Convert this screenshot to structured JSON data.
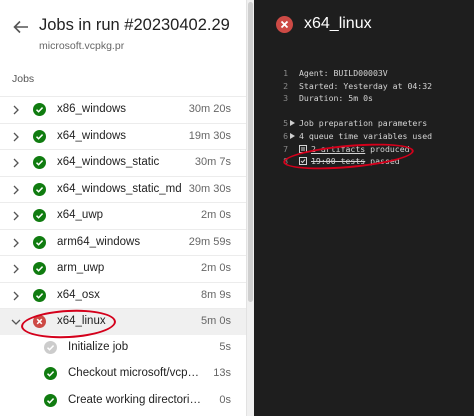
{
  "header": {
    "title": "Jobs in run #20230402.29",
    "subtitle": "microsoft.vcpkg.pr"
  },
  "jobs_heading": "Jobs",
  "jobs": [
    {
      "name": "x86_windows",
      "duration": "30m 20s",
      "status": "success"
    },
    {
      "name": "x64_windows",
      "duration": "19m 30s",
      "status": "success"
    },
    {
      "name": "x64_windows_static",
      "duration": "30m 7s",
      "status": "success"
    },
    {
      "name": "x64_windows_static_md",
      "duration": "30m 30s",
      "status": "success"
    },
    {
      "name": "x64_uwp",
      "duration": "2m 0s",
      "status": "success"
    },
    {
      "name": "arm64_windows",
      "duration": "29m 59s",
      "status": "success"
    },
    {
      "name": "arm_uwp",
      "duration": "2m 0s",
      "status": "success"
    },
    {
      "name": "x64_osx",
      "duration": "8m 9s",
      "status": "success"
    }
  ],
  "selected_job": {
    "name": "x64_linux",
    "duration": "5m 0s",
    "status": "failed"
  },
  "steps": [
    {
      "name": "Initialize job",
      "duration": "5s",
      "status": "skipped"
    },
    {
      "name": "Checkout microsoft/vcpkg@r...",
      "duration": "13s",
      "status": "success"
    },
    {
      "name": "Create working directories",
      "duration": "0s",
      "status": "success"
    }
  ],
  "detail": {
    "title": "x64_linux",
    "log": [
      {
        "num": "1",
        "text": "Agent: BUILD00003V"
      },
      {
        "num": "2",
        "text": "Started: Yesterday at 04:32"
      },
      {
        "num": "3",
        "text": "Duration: 5m 0s"
      },
      {
        "num": "5",
        "text": "Job preparation parameters"
      },
      {
        "num": "6",
        "text": "4 queue time variables used"
      },
      {
        "num": "7",
        "link": "2 artifacts",
        "text": " produced"
      },
      {
        "num": "8",
        "link": "19:00 tests",
        "text": " passed"
      }
    ]
  },
  "colors": {
    "success": "#107c10",
    "failed": "#cd4a45",
    "skipped": "#cccccc",
    "annotation": "#d4001b",
    "dark_bg": "#1e1e1e"
  }
}
